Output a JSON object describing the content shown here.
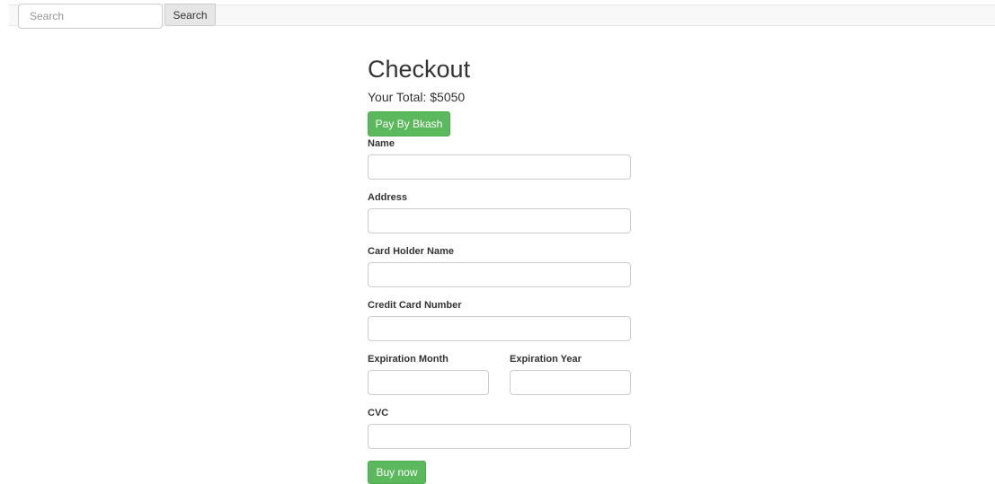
{
  "navbar": {
    "search_placeholder": "Search",
    "search_button_label": "Search"
  },
  "checkout": {
    "title": "Checkout",
    "total_text": "Your Total: $5050",
    "pay_button_label": "Pay By Bkash",
    "buy_button_label": "Buy now",
    "button_color": "#5cb85c",
    "fields": {
      "name_label": "Name",
      "address_label": "Address",
      "card_holder_label": "Card Holder Name",
      "card_number_label": "Credit Card Number",
      "exp_month_label": "Expiration Month",
      "exp_year_label": "Expiration Year",
      "cvc_label": "CVC"
    },
    "values": {
      "name": "",
      "address": "",
      "card_holder": "",
      "card_number": "",
      "exp_month": "",
      "exp_year": "",
      "cvc": ""
    }
  }
}
